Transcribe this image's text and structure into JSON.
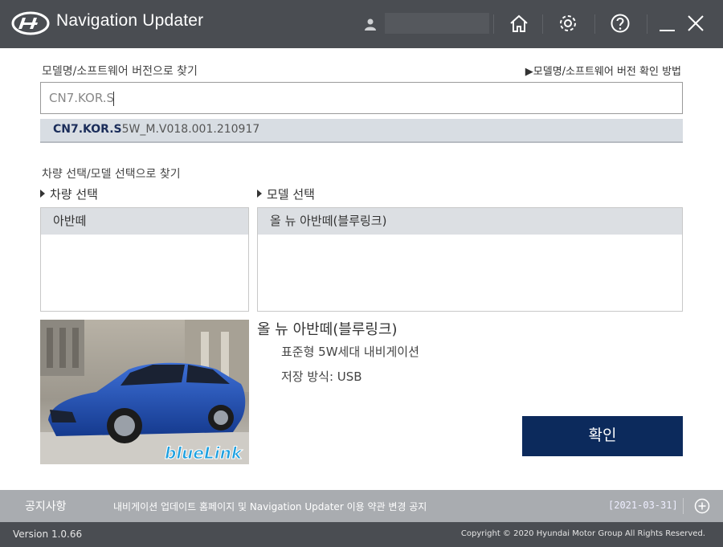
{
  "window": {
    "title": "Navigation Updater",
    "icons": [
      "hyundai-logo",
      "user-icon",
      "home-icon",
      "gear-icon",
      "help-icon",
      "minimize-icon",
      "close-icon"
    ]
  },
  "search": {
    "label": "모델명/소프트웨어 버전으로 찾기",
    "howto_link": "▶모델명/소프트웨어 버전 확인 방법",
    "input_value": "CN7.KOR.S",
    "suggestion_match": "CN7.KOR.S",
    "suggestion_rest": "5W_M.V018.001.210917"
  },
  "vehicle_select": {
    "label": "차량 선택/모델 선택으로 찾기",
    "vehicle_label": "차량 선택",
    "model_label": "모델 선택",
    "vehicles": [
      "아반떼"
    ],
    "models": [
      "올 뉴 아반떼(블루링크)"
    ]
  },
  "info": {
    "model_name": "올 뉴 아반떼(블루링크)",
    "nav_type": "표준형 5W세대 내비게이션",
    "storage": "저장 방식: USB",
    "image_badge": "blueLink"
  },
  "confirm_button": "확인",
  "notice": {
    "title": "공지사항",
    "text": "내비게이션 업데이트 홈페이지 및 Navigation Updater 이용 약관 변경 공지",
    "date": "[2021-03-31]"
  },
  "footer": {
    "version": "Version 1.0.66",
    "copyright": "Copyright © 2020 Hyundai Motor Group All Rights Reserved."
  },
  "colors": {
    "titlebar": "#4a4d52",
    "accent": "#0c2a5c",
    "notice_bar": "#a9acb0"
  }
}
